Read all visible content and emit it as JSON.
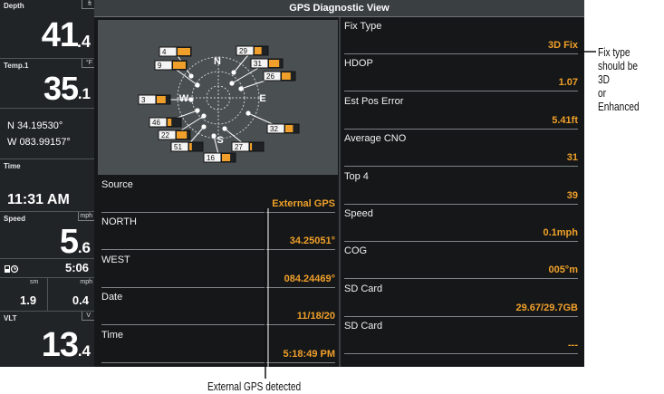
{
  "sidebar": {
    "depth": {
      "label": "Depth",
      "unit": "ft",
      "int": "41",
      "dec": ".4"
    },
    "temp": {
      "label": "Temp.1",
      "unit": "°F",
      "int": "35",
      "dec": ".1"
    },
    "position": {
      "lat": "N 34.19530°",
      "lon": "W 083.99157°"
    },
    "time": {
      "label": "Time",
      "value": "11:31 AM"
    },
    "speed": {
      "label": "Speed",
      "unit": "mph",
      "int": "5",
      "dec": ".6"
    },
    "trip": {
      "icon": "fuel-timer-icon",
      "time": "5:06",
      "left_unit": "sm",
      "right_unit": "mph",
      "left_value": "1.9",
      "right_value": "0.4"
    },
    "voltage": {
      "label": "VLT",
      "unit": "V",
      "int": "13",
      "dec": ".4"
    }
  },
  "header": {
    "title": "GPS Diagnostic View"
  },
  "sky": {
    "compass": {
      "n": "N",
      "e": "E",
      "s": "S",
      "w": "W"
    },
    "satellites": [
      {
        "id": "4"
      },
      {
        "id": "9"
      },
      {
        "id": "29"
      },
      {
        "id": "31"
      },
      {
        "id": "26"
      },
      {
        "id": "3"
      },
      {
        "id": "46"
      },
      {
        "id": "22"
      },
      {
        "id": "51"
      },
      {
        "id": "32"
      },
      {
        "id": "27"
      },
      {
        "id": "16"
      }
    ]
  },
  "left_fields": [
    {
      "label": "Source",
      "value": "External GPS"
    },
    {
      "label": "NORTH",
      "value": "34.25051°"
    },
    {
      "label": "WEST",
      "value": "084.24469°"
    },
    {
      "label": "Date",
      "value": "11/18/20"
    },
    {
      "label": "Time",
      "value": "5:18:49 PM"
    }
  ],
  "right_fields": [
    {
      "label": "Fix Type",
      "value": "3D Fix"
    },
    {
      "label": "HDOP",
      "value": "1.07"
    },
    {
      "label": "Est Pos Error",
      "value": "5.41ft"
    },
    {
      "label": "Average CNO",
      "value": "31"
    },
    {
      "label": "Top 4",
      "value": "39"
    },
    {
      "label": "Speed",
      "value": "0.1mph"
    },
    {
      "label": "COG",
      "value": "005°m"
    },
    {
      "label": "SD Card",
      "value": "29.67/29.7GB"
    },
    {
      "label": "SD Card",
      "value": "---"
    }
  ],
  "callouts": {
    "fix_type_note": [
      "Fix type",
      "should be 3D",
      "or Enhanced"
    ],
    "external_gps_note": "External GPS detected"
  },
  "colors": {
    "value_orange": "#f0a02a",
    "bar_fill": "#f0a02a",
    "panel_bg": "#151718"
  }
}
